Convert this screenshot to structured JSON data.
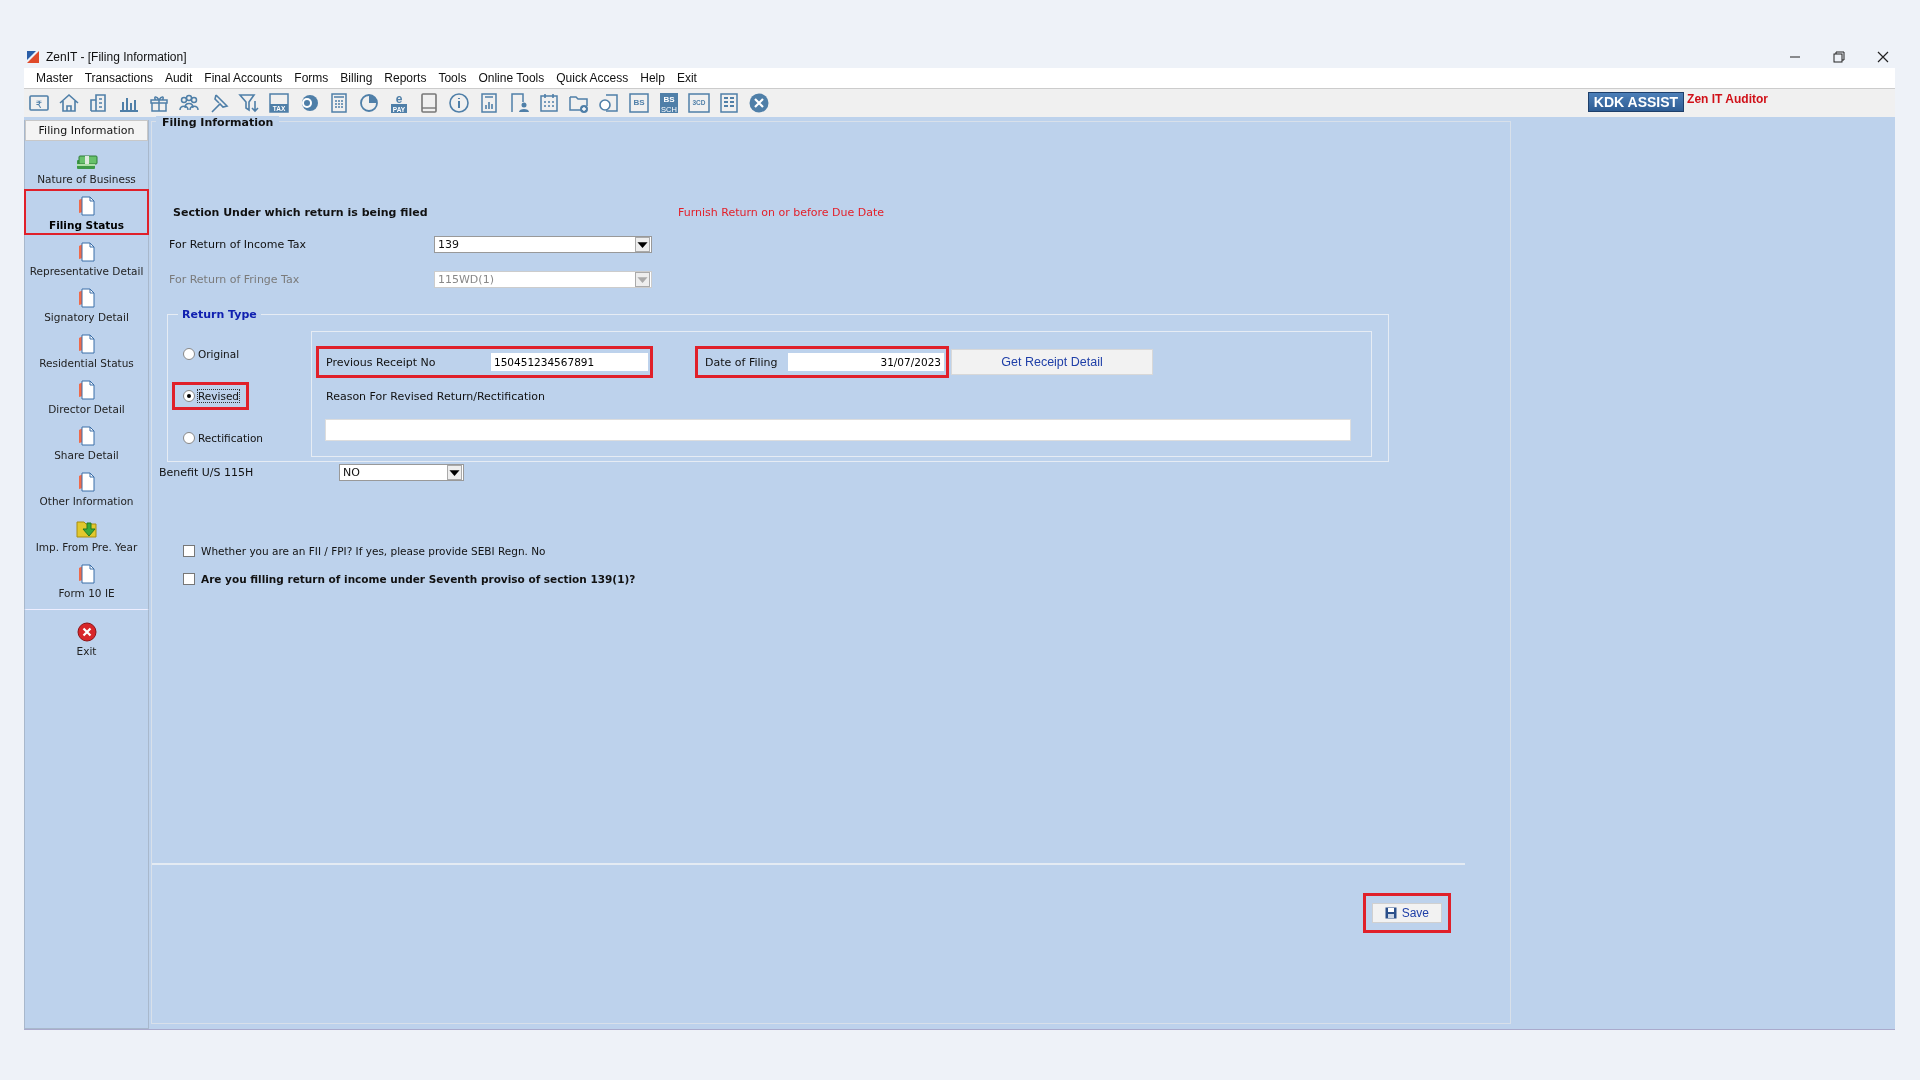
{
  "window": {
    "title": "ZenIT - [Filing Information]",
    "controls": [
      {
        "kind": "minimize"
      },
      {
        "kind": "restore"
      },
      {
        "kind": "close"
      }
    ]
  },
  "menu": [
    "Master",
    "Transactions",
    "Audit",
    "Final Accounts",
    "Forms",
    "Billing",
    "Reports",
    "Tools",
    "Online Tools",
    "Quick Access",
    "Help",
    "Exit"
  ],
  "toolbar": [
    {
      "kind": "rupee",
      "label": "₹"
    },
    {
      "kind": "home"
    },
    {
      "kind": "building"
    },
    {
      "kind": "chart"
    },
    {
      "kind": "gift"
    },
    {
      "kind": "people"
    },
    {
      "kind": "pin"
    },
    {
      "kind": "filter"
    },
    {
      "kind": "tax",
      "label": "TAX"
    },
    {
      "kind": "disc"
    },
    {
      "kind": "calculator"
    },
    {
      "kind": "pie"
    },
    {
      "kind": "pay",
      "label": "PAY",
      "sub": "e"
    },
    {
      "kind": "book"
    },
    {
      "kind": "info"
    },
    {
      "kind": "report"
    },
    {
      "kind": "userdoc"
    },
    {
      "kind": "calendar"
    },
    {
      "kind": "folderadd"
    },
    {
      "kind": "folderlink"
    },
    {
      "kind": "bs",
      "label": "BS"
    },
    {
      "kind": "bssch",
      "label": "BS",
      "sub": "SCH"
    },
    {
      "kind": "cd",
      "label": "3CD"
    },
    {
      "kind": "sheet"
    },
    {
      "kind": "close"
    }
  ],
  "brand": {
    "badge": "KDK ASSIST",
    "product": "Zen IT Auditor"
  },
  "sidebar": {
    "header": "Filing Information",
    "items": [
      {
        "label": "Nature of Business",
        "kind": "money",
        "selected": false,
        "highlighted": false
      },
      {
        "label": "Filing Status",
        "kind": "doc",
        "selected": true,
        "highlighted": true
      },
      {
        "label": "Representative Detail",
        "kind": "doc",
        "selected": false,
        "highlighted": false
      },
      {
        "label": "Signatory Detail",
        "kind": "doc",
        "selected": false,
        "highlighted": false
      },
      {
        "label": "Residential Status",
        "kind": "doc",
        "selected": false,
        "highlighted": false
      },
      {
        "label": "Director Detail",
        "kind": "doc",
        "selected": false,
        "highlighted": false
      },
      {
        "label": "Share Detail",
        "kind": "doc",
        "selected": false,
        "highlighted": false
      },
      {
        "label": "Other Information",
        "kind": "doc",
        "selected": false,
        "highlighted": false
      },
      {
        "label": "Imp. From Pre. Year",
        "kind": "import",
        "selected": false,
        "highlighted": false
      },
      {
        "label": "Form 10 IE",
        "kind": "doc",
        "selected": false,
        "highlighted": false
      },
      {
        "label": "Exit",
        "kind": "exit",
        "selected": false,
        "highlighted": false
      }
    ]
  },
  "form": {
    "title": "Filing Information",
    "section_heading": "Section Under which return is being filed",
    "notice": "Furnish Return on or before Due Date",
    "income_tax": {
      "label": "For Return of Income Tax",
      "value": "139",
      "disabled": false
    },
    "fringe_tax": {
      "label": "For Return of Fringe Tax",
      "value": "115WD(1)",
      "disabled": true
    },
    "return_type": {
      "legend": "Return Type",
      "options": [
        {
          "label": "Original",
          "selected": false,
          "highlighted": false
        },
        {
          "label": "Revised",
          "selected": true,
          "highlighted": true
        },
        {
          "label": "Rectification",
          "selected": false,
          "highlighted": false
        }
      ],
      "previous_receipt": {
        "label": "Previous Receipt No",
        "value": "150451234567891",
        "highlighted": true
      },
      "date_of_filing": {
        "label": "Date of Filing",
        "value": "31/07/2023",
        "highlighted": true
      },
      "get_receipt_button": "Get Receipt Detail",
      "reason": {
        "label": "Reason For Revised Return/Rectification"
      }
    },
    "benefit": {
      "label": "Benefit U/S 115H",
      "value": "NO"
    },
    "checks": [
      {
        "label": "Whether you are an FII / FPI?  If yes, please provide SEBI Regn. No",
        "checked": false,
        "bold": false
      },
      {
        "label": "Are you filling return of income under Seventh proviso of section 139(1)?",
        "checked": false,
        "bold": true
      }
    ],
    "save": {
      "label": "Save",
      "highlighted": true
    }
  }
}
